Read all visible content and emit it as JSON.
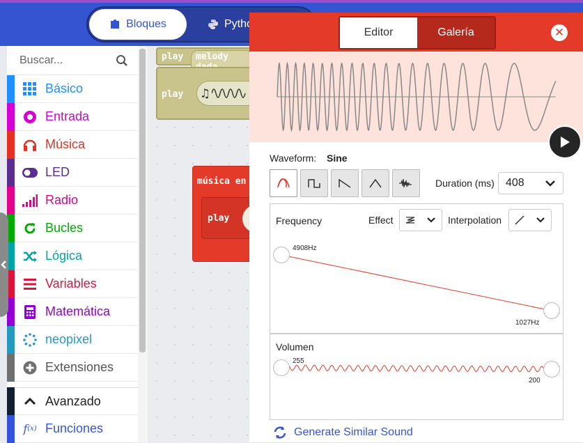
{
  "header": {
    "blocks_label": "Bloques",
    "python_label": "Pytho"
  },
  "toolbox": {
    "search_placeholder": "Buscar...",
    "categories": [
      {
        "label": "Básico",
        "color": "#1e90ff",
        "icon": "grid-icon"
      },
      {
        "label": "Entrada",
        "color": "#d400d4",
        "icon": "target-icon"
      },
      {
        "label": "Música",
        "color": "#e63022",
        "icon": "headphones-icon"
      },
      {
        "label": "LED",
        "color": "#5c2d91",
        "icon": "toggle-icon"
      },
      {
        "label": "Radio",
        "color": "#e3008c",
        "icon": "signal-bars-icon"
      },
      {
        "label": "Bucles",
        "color": "#00aa00",
        "icon": "refresh-icon"
      },
      {
        "label": "Lógica",
        "color": "#00a4a6",
        "icon": "shuffle-icon"
      },
      {
        "label": "Variables",
        "color": "#dc143c",
        "icon": "lines-icon"
      },
      {
        "label": "Matemática",
        "color": "#9400d3",
        "icon": "calculator-icon"
      },
      {
        "label": "neopixel",
        "color": "#2699bf",
        "icon": "dots-circle-icon"
      },
      {
        "label": "Extensiones",
        "color": "#707070",
        "icon": "plus-circle-icon"
      },
      {
        "label": "Avanzado",
        "color": "#102030",
        "icon": "chevron-up-icon"
      },
      {
        "label": "Funciones",
        "color": "#3455db",
        "icon": "fx-icon"
      }
    ]
  },
  "workspace": {
    "block1_play": "play",
    "block1_melody": "melody dada",
    "block2_play": "play",
    "block3_title": "música en",
    "block3_play": "play"
  },
  "sound_editor": {
    "tab_editor": "Editor",
    "tab_gallery": "Galería",
    "waveform_label": "Waveform:",
    "waveform_value": "Sine",
    "waveforms_shown": [
      "sine",
      "square",
      "sawtooth",
      "triangle",
      "noise"
    ],
    "selected_waveform": "sine",
    "duration_label": "Duration (ms)",
    "duration_value": "408",
    "frequency_label": "Frequency",
    "effect_label": "Effect",
    "interpolation_label": "Interpolation",
    "freq_start": "4908Hz",
    "freq_end": "1027Hz",
    "volume_label": "Volumen",
    "vol_start": "255",
    "vol_end": "200",
    "generate_label": "Generate Similar Sound",
    "accent_color": "#e43a2a",
    "link_color": "#3454d1"
  }
}
